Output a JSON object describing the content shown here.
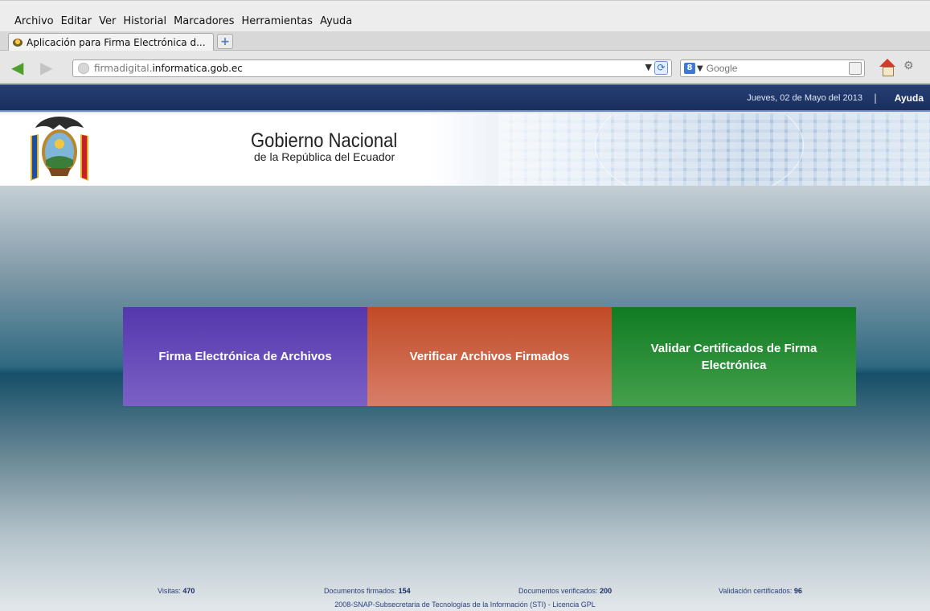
{
  "browser": {
    "menu": [
      "Archivo",
      "Editar",
      "Ver",
      "Historial",
      "Marcadores",
      "Herramientas",
      "Ayuda"
    ],
    "tab_title": "Aplicación para Firma Electrónica d...",
    "url_host": "firmadigital.",
    "url_domain": "informatica.gob.ec",
    "search_placeholder": "Google"
  },
  "page": {
    "date": "Jueves, 02 de Mayo del 2013",
    "separator": "|",
    "help_link": "Ayuda",
    "header_title": "Gobierno Nacional",
    "header_subtitle": "de la República del Ecuador",
    "tiles": [
      {
        "label": "Firma Electrónica de Archivos",
        "color": "#5f45b6"
      },
      {
        "label": "Verificar Archivos Firmados",
        "color": "#c9583a"
      },
      {
        "label": "Validar Certificados de Firma Electrónica",
        "color": "#1f8a30"
      }
    ],
    "stats": {
      "visits_label": "Visitas:",
      "visits_value": "470",
      "signed_label": "Documentos firmados:",
      "signed_value": "154",
      "verified_label": "Documentos verificados:",
      "verified_value": "200",
      "validation_label": "Validación certificados:",
      "validation_value": "96"
    },
    "footer": "2008-SNAP-Subsecretaria de Tecnologías de la Información (STI) - Licencia GPL"
  }
}
